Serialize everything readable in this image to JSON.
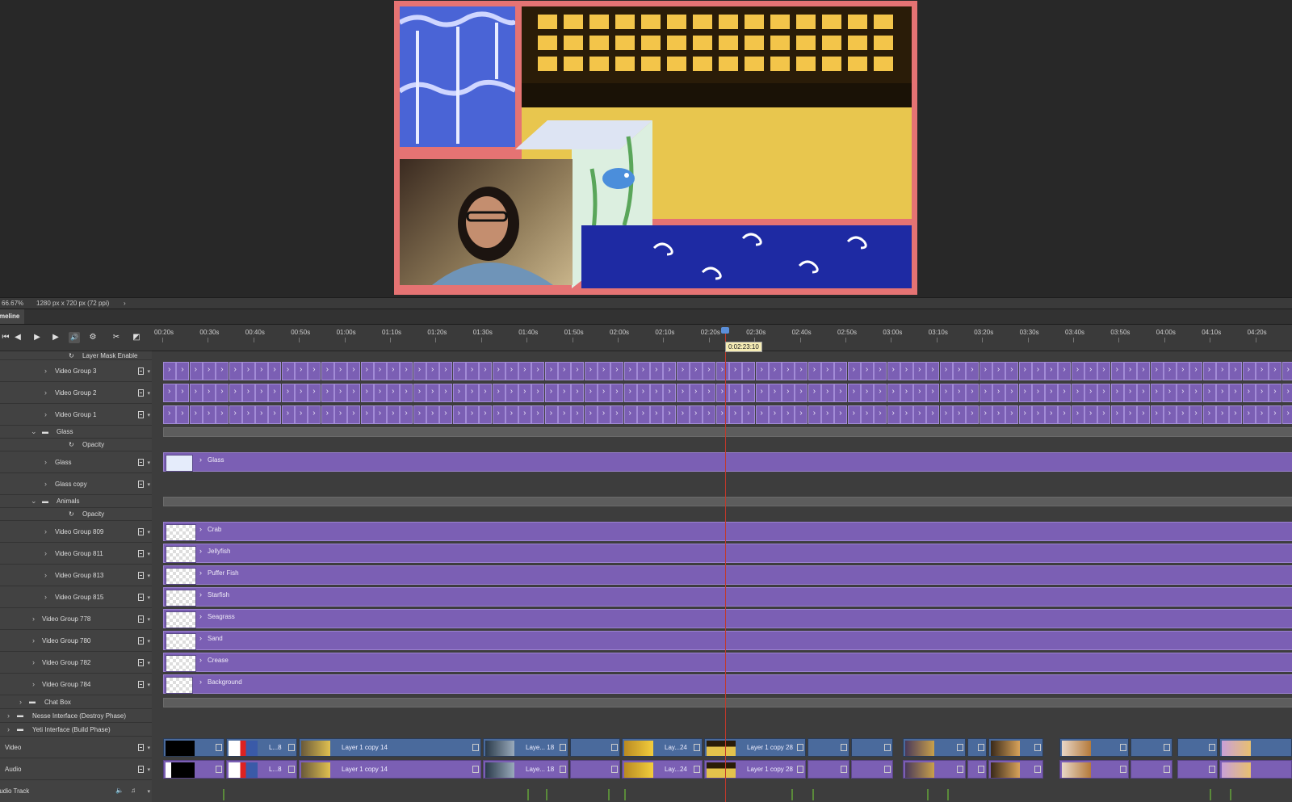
{
  "status": {
    "zoom": "66.67%",
    "doc_size": "1280 px x 720 px (72 ppi)",
    "arrow": "›"
  },
  "timeline_tab": "Timeline",
  "controls": {
    "first": "⏮",
    "prev": "◀",
    "play": "▶",
    "next": "▶",
    "mute": "🔊",
    "settings": "⚙",
    "split": "✂",
    "transition": "◩"
  },
  "ruler_ticks": [
    "00:20s",
    "00:30s",
    "00:40s",
    "00:50s",
    "01:00s",
    "01:10s",
    "01:20s",
    "01:30s",
    "01:40s",
    "01:50s",
    "02:00s",
    "02:10s",
    "02:20s",
    "02:30s",
    "02:40s",
    "02:50s",
    "03:00s",
    "03:10s",
    "03:20s",
    "03:30s",
    "03:40s",
    "03:50s",
    "04:00s",
    "04:10s",
    "04:20s"
  ],
  "current_time": "0:02:23:10",
  "layers": {
    "layer_mask": "Layer Mask Enable",
    "vg3": "Video Group 3",
    "vg2": "Video Group 2",
    "vg1": "Video Group 1",
    "glass_group": "Glass",
    "glass_opacity": "Opacity",
    "glass": "Glass",
    "glass_copy": "Glass copy",
    "animals_group": "Animals",
    "animals_opacity": "Opacity",
    "vg809": "Video Group 809",
    "vg811": "Video Group 811",
    "vg813": "Video Group 813",
    "vg815": "Video Group 815",
    "vg778": "Video Group 778",
    "vg780": "Video Group 780",
    "vg782": "Video Group 782",
    "vg784": "Video Group 784",
    "chat_box": "Chat Box",
    "nesse": "Nesse Interface (Destroy Phase)",
    "yeti": "Yeti Interface (Build Phase)",
    "video": "Video",
    "audio": "Audio",
    "audio_track": "Audio Track"
  },
  "clips": {
    "glass": "Glass",
    "crab": "Crab",
    "jellyfish": "Jellyfish",
    "puffer": "Puffer Fish",
    "starfish": "Starfish",
    "seagrass": "Seagrass",
    "sand": "Sand",
    "crease": "Crease",
    "background": "Background"
  },
  "video_clips": [
    "L...8",
    "Layer 1 copy 14",
    "Laye... 18",
    "Lay...24",
    "Layer 1 copy 28"
  ],
  "audio_clips": [
    "L...8",
    "Layer 1 copy 14",
    "Laye... 18",
    "Lay...24",
    "Layer 1 copy 28"
  ]
}
